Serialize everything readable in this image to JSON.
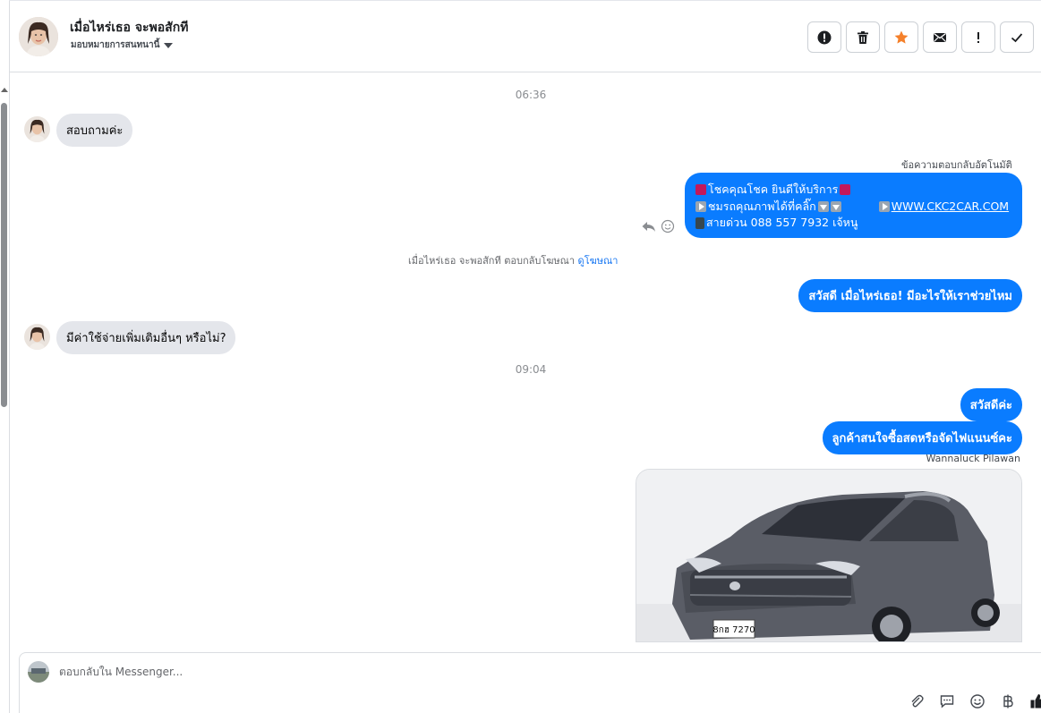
{
  "header": {
    "contact_name": "เมื่อไหร่เธอ จะพอสักที",
    "assign_label": "มอบหมายการสนทนานี้",
    "toolbar": [
      {
        "icon": "alert-circle-icon"
      },
      {
        "icon": "trash-icon"
      },
      {
        "icon": "star-icon",
        "color": "#f5802a"
      },
      {
        "icon": "envelope-icon"
      },
      {
        "icon": "exclamation-icon"
      },
      {
        "icon": "checkmark-icon"
      }
    ]
  },
  "conversation": {
    "timestamp_1": "06:36",
    "msg_in_1": "สอบถามค่ะ",
    "auto_reply_label": "ข้อความตอบกลับอัตโนมัติ",
    "auto_reply": {
      "line1": "โชคคุณโชค ยินดีให้บริการ",
      "line2": "ชมรถคุณภาพได้ที่คลิ๊ก",
      "link": "WWW.CKC2CAR.COM",
      "line3": "สายด่วน 088 557 7932 เจ้หนู"
    },
    "ad_reply_text": "เมื่อไหร่เธอ จะพอสักที ตอบกลับโฆษณา",
    "ad_reply_link": "ดูโฆษณา",
    "msg_out_1": "สวัสดี เมื่อไหร่เธอ! มีอะไรให้เราช่วยไหม",
    "msg_in_2": "มีค่าใช้จ่ายเพิ่มเติมอื่นๆ หรือไม่?",
    "timestamp_2": "09:04",
    "msg_out_2": "สวัสดีค่ะ",
    "msg_out_3": "ลูกค้าสนใจซื้อสดหรือจัดไฟแนนซ์คะ",
    "sender_name": "Wannaluck Pilawan",
    "car_plate": "8กฮ 7270"
  },
  "composer": {
    "placeholder": "ตอบกลับใน Messenger..."
  },
  "colors": {
    "outgoing_bubble": "#0a7cff",
    "incoming_bubble": "#e4e6eb",
    "star": "#f5802a"
  }
}
